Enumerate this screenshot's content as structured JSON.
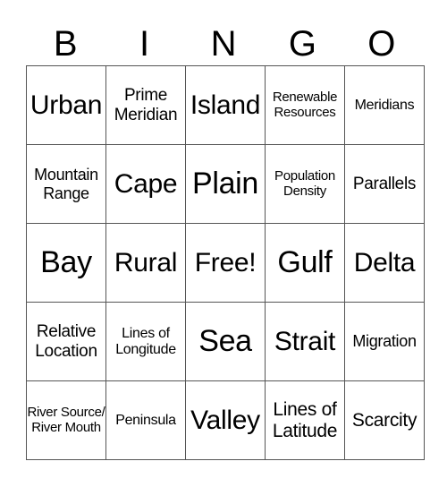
{
  "header": [
    "B",
    "I",
    "N",
    "G",
    "O"
  ],
  "rows": [
    [
      {
        "t": "Urban",
        "s": "s30"
      },
      {
        "t": "Prime Meridian",
        "s": "s19"
      },
      {
        "t": "Island",
        "s": "s30"
      },
      {
        "t": "Renewable Resources",
        "s": "s15"
      },
      {
        "t": "Meridians",
        "s": "s16"
      }
    ],
    [
      {
        "t": "Mountain Range",
        "s": "s18"
      },
      {
        "t": "Cape",
        "s": "s30"
      },
      {
        "t": "Plain",
        "s": "s34"
      },
      {
        "t": "Population Density",
        "s": "s15"
      },
      {
        "t": "Parallels",
        "s": "s19"
      }
    ],
    [
      {
        "t": "Bay",
        "s": "s34"
      },
      {
        "t": "Rural",
        "s": "s30"
      },
      {
        "t": "Free!",
        "s": "s30"
      },
      {
        "t": "Gulf",
        "s": "s34"
      },
      {
        "t": "Delta",
        "s": "s30"
      }
    ],
    [
      {
        "t": "Relative Location",
        "s": "s19"
      },
      {
        "t": "Lines of Longitude",
        "s": "s16"
      },
      {
        "t": "Sea",
        "s": "s34"
      },
      {
        "t": "Strait",
        "s": "s30"
      },
      {
        "t": "Migration",
        "s": "s18"
      }
    ],
    [
      {
        "t": "River Source/ River Mouth",
        "s": "s15"
      },
      {
        "t": "Peninsula",
        "s": "s16"
      },
      {
        "t": "Valley",
        "s": "s30"
      },
      {
        "t": "Lines of Latitude",
        "s": "s21"
      },
      {
        "t": "Scarcity",
        "s": "s21"
      }
    ]
  ]
}
